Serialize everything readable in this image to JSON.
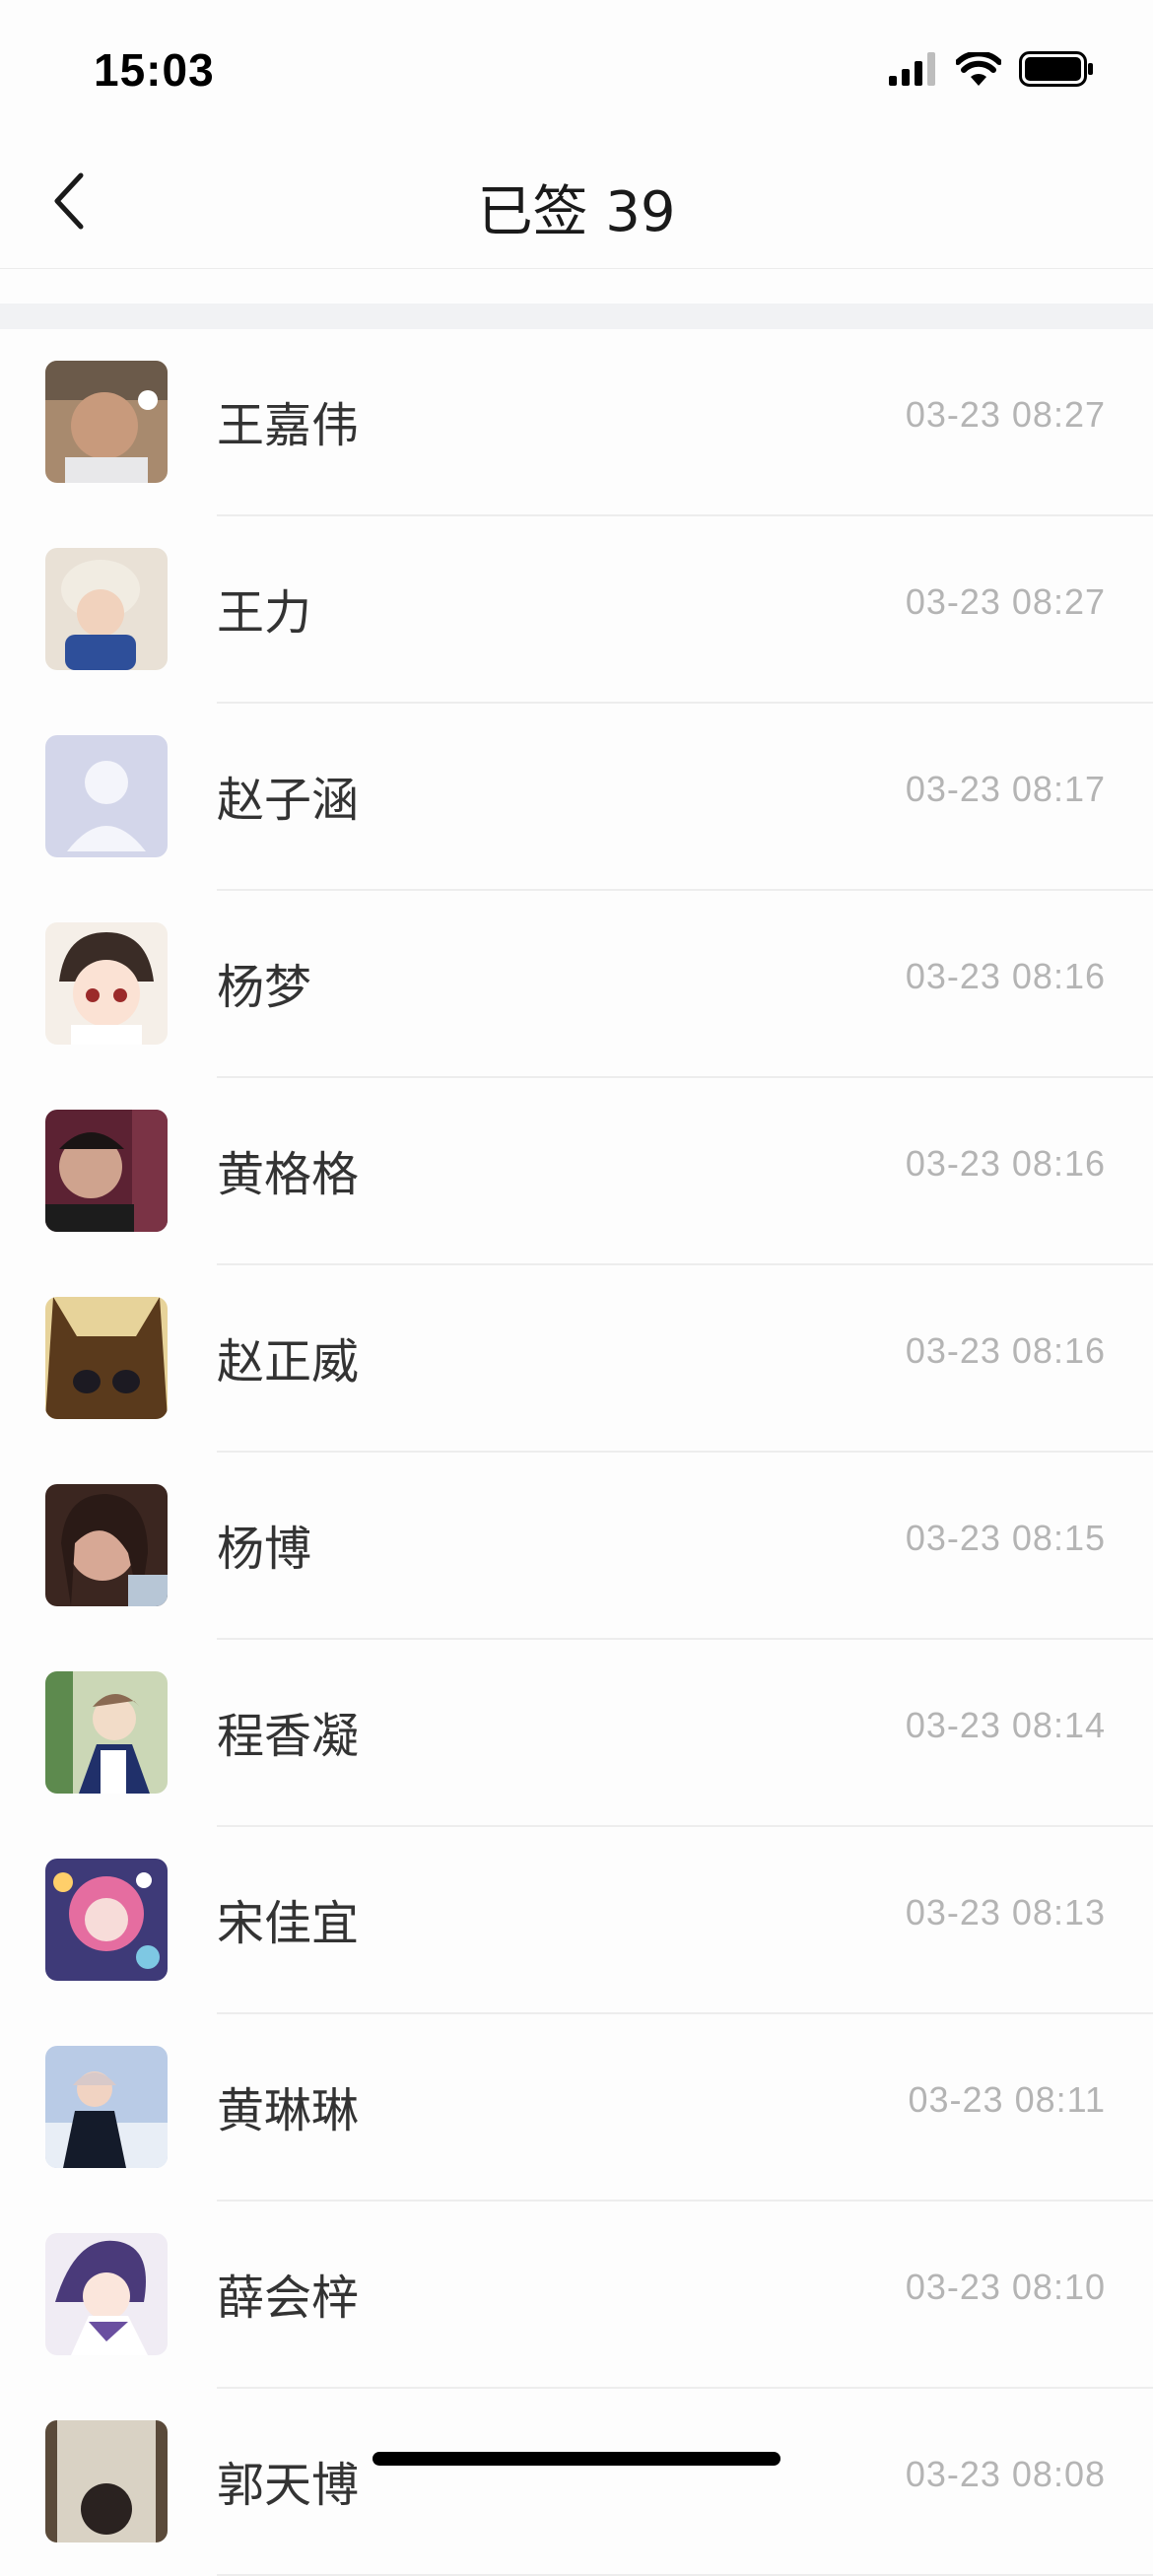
{
  "status_bar": {
    "time": "15:03",
    "icons": [
      "cellular-signal-icon",
      "wifi-icon",
      "battery-icon"
    ]
  },
  "nav": {
    "back_icon": "chevron-left-icon",
    "title": "已签 39"
  },
  "colors": {
    "background": "#fdfdfd",
    "separator": "#f1f2f4",
    "name_text": "#333333",
    "time_text": "#b4b4b4",
    "divider": "#ededed"
  },
  "records": [
    {
      "name": "王嘉伟",
      "time": "03-23 08:27",
      "avatar": "photo-avatar"
    },
    {
      "name": "王力",
      "time": "03-23 08:27",
      "avatar": "photo-avatar"
    },
    {
      "name": "赵子涵",
      "time": "03-23 08:17",
      "avatar": "default-person-avatar"
    },
    {
      "name": "杨梦",
      "time": "03-23 08:16",
      "avatar": "cartoon-avatar"
    },
    {
      "name": "黄格格",
      "time": "03-23 08:16",
      "avatar": "photo-avatar"
    },
    {
      "name": "赵正威",
      "time": "03-23 08:16",
      "avatar": "cartoon-avatar"
    },
    {
      "name": "杨博",
      "time": "03-23 08:15",
      "avatar": "photo-avatar"
    },
    {
      "name": "程香凝",
      "time": "03-23 08:14",
      "avatar": "anime-avatar"
    },
    {
      "name": "宋佳宜",
      "time": "03-23 08:13",
      "avatar": "anime-avatar"
    },
    {
      "name": "黄琳琳",
      "time": "03-23 08:11",
      "avatar": "photo-avatar"
    },
    {
      "name": "薛会梓",
      "time": "03-23 08:10",
      "avatar": "anime-avatar"
    },
    {
      "name": "郭天博",
      "time": "03-23 08:08",
      "avatar": "photo-avatar"
    }
  ]
}
